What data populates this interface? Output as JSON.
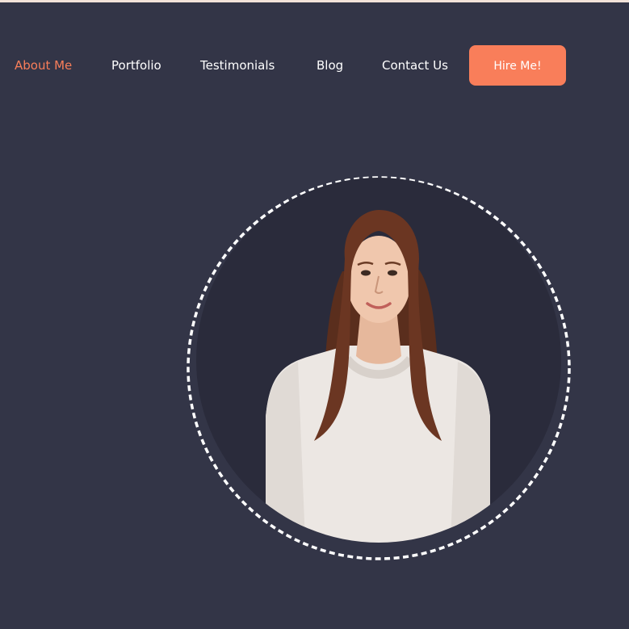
{
  "nav": {
    "items": [
      {
        "label": "About Me",
        "active": true
      },
      {
        "label": "Portfolio"
      },
      {
        "label": "Testimonials"
      },
      {
        "label": "Blog"
      },
      {
        "label": "Contact Us"
      }
    ],
    "cta_label": "Hire Me!"
  },
  "colors": {
    "background": "#333547",
    "accent": "#f97e5a",
    "photo_backdrop": "#2a2b3b",
    "ring": "#ffffff"
  },
  "hero": {
    "photo": "portrait-photo",
    "photo_frame": "dashed-circle-ring"
  }
}
